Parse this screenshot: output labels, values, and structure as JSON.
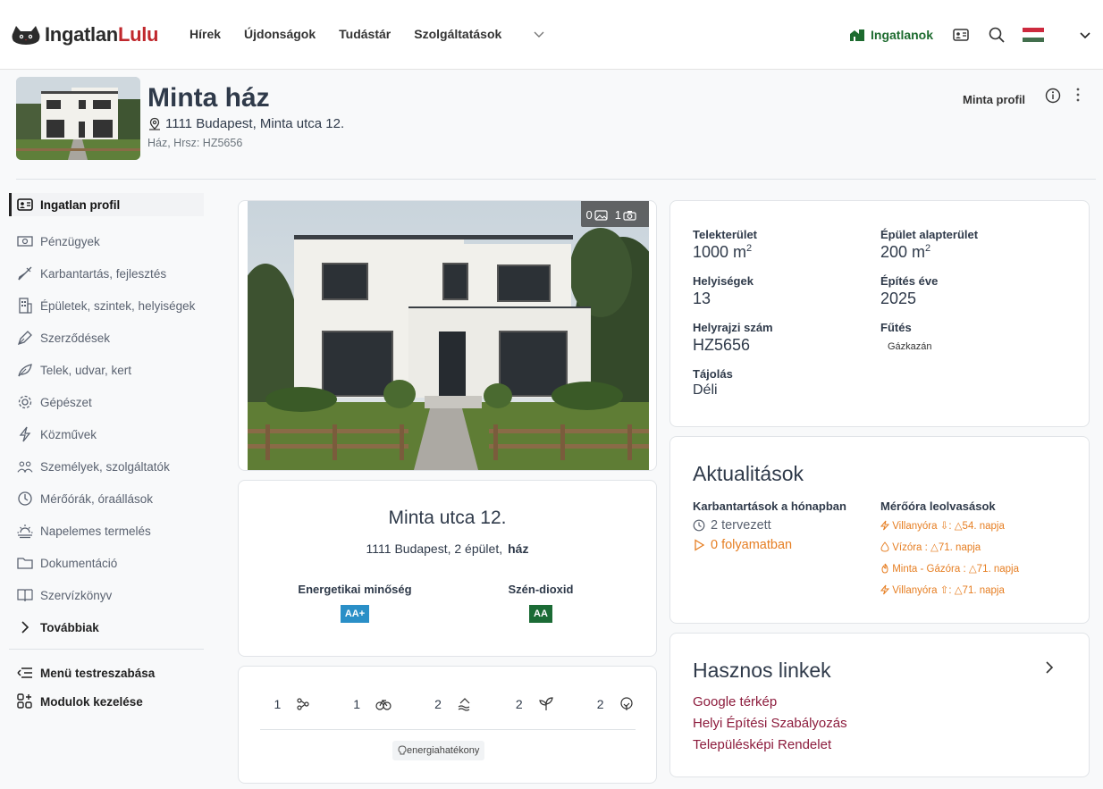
{
  "brand": {
    "part1": "Ingatlan",
    "part2": "Lulu"
  },
  "nav": {
    "items": [
      "Hírek",
      "Újdonságok",
      "Tudástár",
      "Szolgáltatások"
    ],
    "properties_label": "Ingatlanok"
  },
  "property": {
    "title": "Minta ház",
    "address": "1111 Budapest, Minta utca 12.",
    "subtitle": "Ház, Hrsz: HZ5656",
    "profile_name": "Minta profil"
  },
  "sidebar": {
    "items": [
      {
        "label": "Ingatlan profil",
        "icon": "id-card-icon"
      },
      {
        "label": "Pénzügyek",
        "icon": "money-icon"
      },
      {
        "label": "Karbantartás, fejlesztés",
        "icon": "brush-icon"
      },
      {
        "label": "Épületek, szintek, helyiségek",
        "icon": "building-icon"
      },
      {
        "label": "Szerződések",
        "icon": "pen-icon"
      },
      {
        "label": "Telek, udvar, kert",
        "icon": "leaf-icon"
      },
      {
        "label": "Gépészet",
        "icon": "gear-icon"
      },
      {
        "label": "Közművek",
        "icon": "lightning-icon"
      },
      {
        "label": "Személyek, szolgáltatók",
        "icon": "people-icon"
      },
      {
        "label": "Mérőórák, óraállások",
        "icon": "clock-icon"
      },
      {
        "label": "Napelemes termelés",
        "icon": "sun-icon"
      },
      {
        "label": "Dokumentáció",
        "icon": "folder-icon"
      },
      {
        "label": "Szervízkönyv",
        "icon": "book-icon"
      },
      {
        "label": "Továbbiak",
        "icon": "chevron-right-icon"
      }
    ],
    "customize": "Menü testreszabása",
    "modules": "Modulok kezelése"
  },
  "photo": {
    "image_count": "0",
    "photo_count": "1"
  },
  "address_card": {
    "title": "Minta utca 12.",
    "line": "1111 Budapest, 2 épület,",
    "type": "ház",
    "energy_label": "Energetikai minőség",
    "energy_value": "AA+",
    "co2_label": "Szén-dioxid",
    "co2_value": "AA",
    "energy_color": "#2a8fc7",
    "co2_color": "#1b6b35"
  },
  "features": {
    "items": [
      {
        "count": "1",
        "icon": "network-icon"
      },
      {
        "count": "1",
        "icon": "bicycle-icon"
      },
      {
        "count": "2",
        "icon": "water-heat-icon"
      },
      {
        "count": "2",
        "icon": "plant-icon"
      },
      {
        "count": "2",
        "icon": "tree-icon"
      }
    ],
    "tag": "energiahatékony"
  },
  "stats": {
    "plot_area_label": "Telekterület",
    "plot_area_value": "1000 m",
    "footprint_label": "Épület alapterület",
    "footprint_value": "200 m",
    "rooms_label": "Helyiségek",
    "rooms_value": "13",
    "year_label": "Építés éve",
    "year_value": "2025",
    "parcel_label": "Helyrajzi szám",
    "parcel_value": "HZ5656",
    "heating_label": "Fűtés",
    "heating_value": "Gázkazán",
    "orientation_label": "Tájolás",
    "orientation_value": "Déli",
    "sup": "2"
  },
  "updates": {
    "title": "Aktualitások",
    "maint_label": "Karbantartások a hónapban",
    "planned": "2 tervezett",
    "in_progress": "0 folyamatban",
    "meters_label": "Mérőóra leolvasások",
    "meters": [
      "Villanyóra ⇩: △54. napja",
      "Vízóra : △71. napja",
      "Minta - Gázóra : △71. napja",
      "Villanyóra ⇧: △71. napja"
    ],
    "accent": "#e67e22"
  },
  "links": {
    "title": "Hasznos linkek",
    "items": [
      "Google térkép",
      "Helyi Építési Szabályozás",
      "Településképi Rendelet"
    ]
  }
}
